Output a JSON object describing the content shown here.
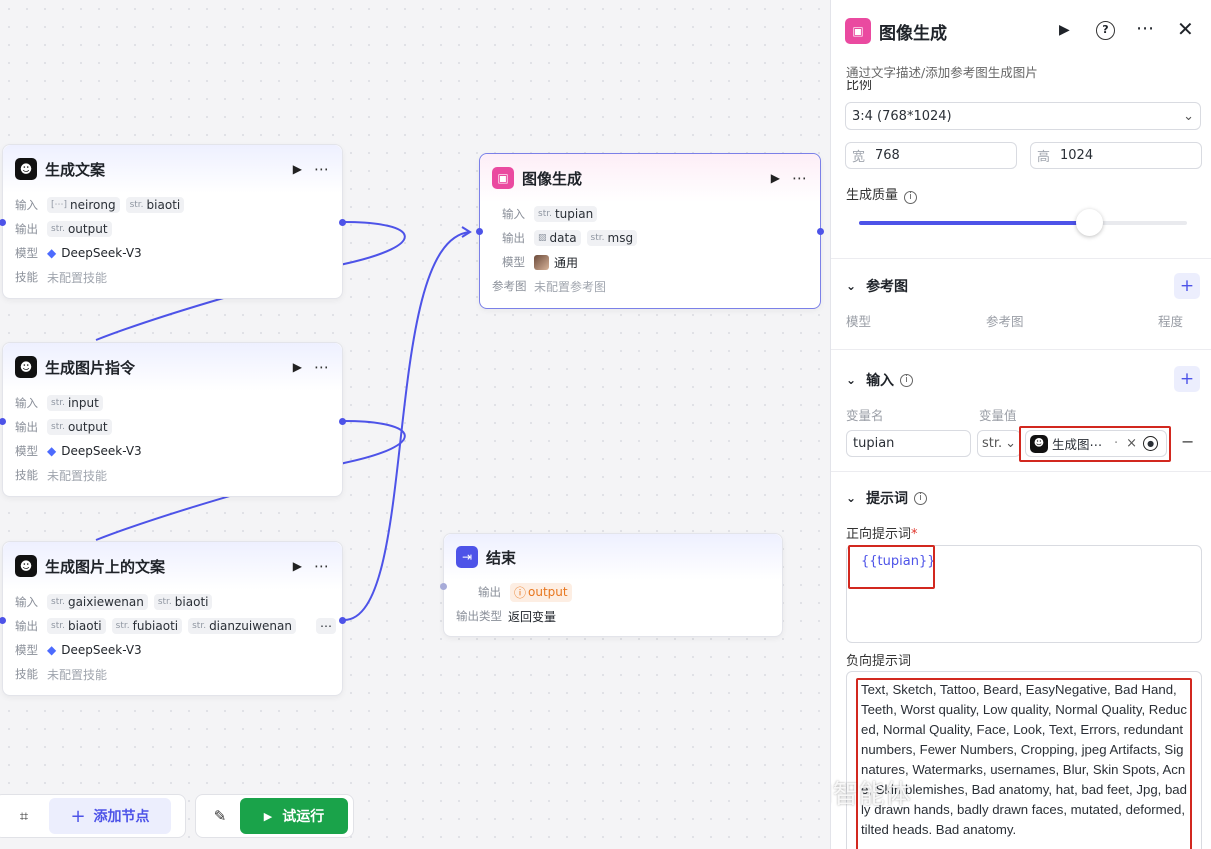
{
  "nodes": {
    "copy": {
      "title": "生成文案",
      "input_label": "输入",
      "output_label": "输出",
      "model_label": "模型",
      "skill_label": "技能",
      "inputs": [
        {
          "type": "[⋯]",
          "name": "neirong"
        },
        {
          "type": "str.",
          "name": "biaoti"
        }
      ],
      "outputs": [
        {
          "type": "str.",
          "name": "output"
        }
      ],
      "model": "DeepSeek-V3",
      "skill": "未配置技能"
    },
    "prompt": {
      "title": "生成图片指令",
      "input_label": "输入",
      "output_label": "输出",
      "model_label": "模型",
      "skill_label": "技能",
      "inputs": [
        {
          "type": "str.",
          "name": "input"
        }
      ],
      "outputs": [
        {
          "type": "str.",
          "name": "output"
        }
      ],
      "model": "DeepSeek-V3",
      "skill": "未配置技能"
    },
    "imgtext": {
      "title": "生成图片上的文案",
      "input_label": "输入",
      "output_label": "输出",
      "model_label": "模型",
      "skill_label": "技能",
      "inputs": [
        {
          "type": "str.",
          "name": "gaixiewenan"
        },
        {
          "type": "str.",
          "name": "biaoti"
        }
      ],
      "outputs": [
        {
          "type": "str.",
          "name": "biaoti"
        },
        {
          "type": "str.",
          "name": "fubiaoti"
        },
        {
          "type": "str.",
          "name": "dianzuiwenan"
        }
      ],
      "more": "⋯",
      "model": "DeepSeek-V3",
      "skill": "未配置技能"
    },
    "imagegen": {
      "title": "图像生成",
      "input_label": "输入",
      "output_label": "输出",
      "model_label": "模型",
      "ref_label": "参考图",
      "inputs": [
        {
          "type": "str.",
          "name": "tupian"
        }
      ],
      "outputs": [
        {
          "type": "img",
          "name": "data"
        },
        {
          "type": "str.",
          "name": "msg"
        }
      ],
      "model": "通用",
      "ref": "未配置参考图"
    },
    "end": {
      "title": "结束",
      "output_label": "输出",
      "output_name": "output",
      "type_label": "输出类型",
      "type_value": "返回变量"
    }
  },
  "toolbar": {
    "add_node": "添加节点",
    "run": "试运行"
  },
  "panel": {
    "title": "图像生成",
    "subtitle": "通过文字描述/添加参考图生成图片",
    "ratio_label": "比例",
    "ratio_value": "3:4 (768*1024)",
    "width_label": "宽",
    "width_value": "768",
    "height_label": "高",
    "height_value": "1024",
    "quality_label": "生成质量",
    "quality_level": 0.7,
    "ref_section": "参考图",
    "ref_cols": [
      "模型",
      "参考图",
      "程度"
    ],
    "input_section": "输入",
    "var_name_label": "变量名",
    "var_value_label": "变量值",
    "var_name": "tupian",
    "var_type": "str.",
    "var_ref": "生成图⋯",
    "var_ref_suffix": "·",
    "prompt_section": "提示词",
    "pos_label": "正向提示词",
    "pos_required": "*",
    "pos_value": "{{tupian}}",
    "neg_label": "负向提示词",
    "neg_value": "Text, Sketch, Tattoo, Beard, EasyNegative, Bad Hand, Teeth, Worst quality, Low quality, Normal Quality, Reduced, Normal Quality, Face, Look, Text, Errors, redundant numbers, Fewer Numbers, Cropping, jpeg Artifacts, Signatures, Watermarks, usernames, Blur, Skin Spots, Acne, Skin blemishes, Bad anatomy, hat, bad feet, Jpg, badly drawn hands, badly drawn faces, mutated, deformed, tilted heads. Bad anatomy.",
    "watermark": "知乎 @AI智能体"
  },
  "colors": {
    "accent": "#4d53e8",
    "run_green": "#1aa34a",
    "highlight_red": "#d2281f"
  }
}
